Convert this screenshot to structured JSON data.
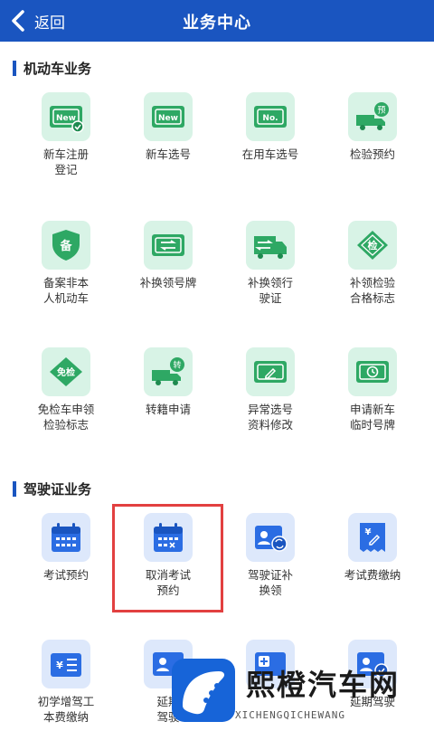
{
  "header": {
    "back_label": "返回",
    "title": "业务中心"
  },
  "sections": {
    "vehicle": {
      "title": "机动车业务",
      "items": [
        {
          "label": "新车注册\n登记",
          "icon": "car-plate-new-check-icon"
        },
        {
          "label": "新车选号",
          "icon": "car-plate-new-icon"
        },
        {
          "label": "在用车选号",
          "icon": "car-plate-no-icon"
        },
        {
          "label": "检验预约",
          "icon": "truck-appointment-icon"
        },
        {
          "label": "备案非本\n人机动车",
          "icon": "shield-record-icon"
        },
        {
          "label": "补换领号牌",
          "icon": "plate-exchange-icon"
        },
        {
          "label": "补换领行\n驶证",
          "icon": "license-exchange-icon"
        },
        {
          "label": "补领检验\n合格标志",
          "icon": "inspection-mark-icon"
        },
        {
          "label": "免检车申领\n检验标志",
          "icon": "exempt-inspection-icon"
        },
        {
          "label": "转籍申请",
          "icon": "truck-transfer-icon"
        },
        {
          "label": "异常选号\n资料修改",
          "icon": "edit-document-icon"
        },
        {
          "label": "申请新车\n临时号牌",
          "icon": "temporary-plate-icon"
        }
      ]
    },
    "license": {
      "title": "驾驶证业务",
      "items": [
        {
          "label": "考试预约",
          "icon": "calendar-icon"
        },
        {
          "label": "取消考试\n预约",
          "icon": "calendar-cancel-icon"
        },
        {
          "label": "驾驶证补\n换领",
          "icon": "id-card-exchange-icon"
        },
        {
          "label": "考试费缴纳",
          "icon": "fee-receipt-icon"
        },
        {
          "label": "初学增驾工\n本费缴纳",
          "icon": "fee-list-icon"
        },
        {
          "label": "延期\n驾驶",
          "icon": "id-card-icon"
        },
        {
          "label": "",
          "icon": "id-card-plus-icon"
        },
        {
          "label": "延期驾驶",
          "icon": "id-card-check-icon"
        }
      ]
    }
  },
  "watermark": {
    "text": "熙橙汽车网",
    "url": "XICHENGQICHEWANG"
  },
  "colors": {
    "primary": "#1a55c0",
    "green_tile": "#d8f3e6",
    "blue_tile": "#dde8fb",
    "highlight": "#e24040"
  }
}
